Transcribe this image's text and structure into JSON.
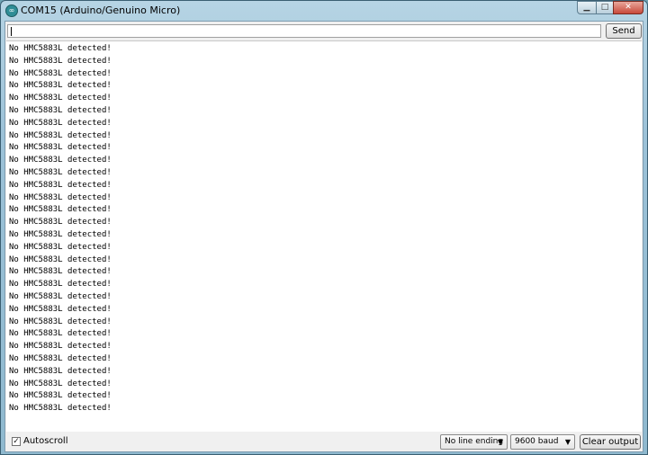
{
  "window": {
    "title": "COM15 (Arduino/Genuino Micro)",
    "icon": "arduino-icon",
    "controls": {
      "minimize_icon": "minimize-icon",
      "maximize_icon": "maximize-icon",
      "close_icon": "close-icon"
    }
  },
  "input": {
    "value": ""
  },
  "send_label": "Send",
  "output": {
    "lines": [
      "No HMC5883L detected!",
      "No HMC5883L detected!",
      "No HMC5883L detected!",
      "No HMC5883L detected!",
      "No HMC5883L detected!",
      "No HMC5883L detected!",
      "No HMC5883L detected!",
      "No HMC5883L detected!",
      "No HMC5883L detected!",
      "No HMC5883L detected!",
      "No HMC5883L detected!",
      "No HMC5883L detected!",
      "No HMC5883L detected!",
      "No HMC5883L detected!",
      "No HMC5883L detected!",
      "No HMC5883L detected!",
      "No HMC5883L detected!",
      "No HMC5883L detected!",
      "No HMC5883L detected!",
      "No HMC5883L detected!",
      "No HMC5883L detected!",
      "No HMC5883L detected!",
      "No HMC5883L detected!",
      "No HMC5883L detected!",
      "No HMC5883L detected!",
      "No HMC5883L detected!",
      "No HMC5883L detected!",
      "No HMC5883L detected!",
      "No HMC5883L detected!",
      "No HMC5883L detected!"
    ]
  },
  "bottom": {
    "autoscroll_label": "Autoscroll",
    "autoscroll_checked": true,
    "line_ending": "No line ending",
    "baud": "9600 baud",
    "clear_label": "Clear output"
  }
}
